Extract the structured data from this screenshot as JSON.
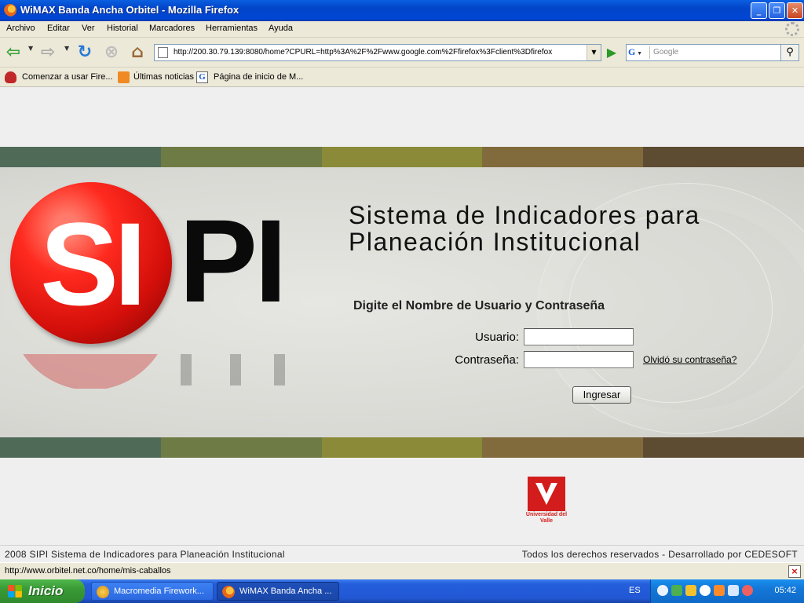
{
  "window": {
    "title": "WiMAX Banda Ancha Orbitel - Mozilla Firefox",
    "minimize_glyph": "_",
    "maximize_glyph": "❐",
    "close_glyph": "✕"
  },
  "menu": {
    "items": [
      "Archivo",
      "Editar",
      "Ver",
      "Historial",
      "Marcadores",
      "Herramientas",
      "Ayuda"
    ]
  },
  "navbar": {
    "url": "http://200.30.79.139:8080/home?CPURL=http%3A%2F%2Fwww.google.com%2Ffirefox%3Fclient%3Dfirefox",
    "search_engine": "G",
    "search_placeholder": "Google"
  },
  "bookmarks": {
    "items": [
      "Comenzar a usar Fire...",
      "Últimas noticias",
      "Página de inicio de M..."
    ]
  },
  "page": {
    "stripe_colors": [
      "#4F6B58",
      "#6F7B45",
      "#8A8A38",
      "#816A3C",
      "#5E4C32"
    ],
    "logo_left": "SI",
    "logo_right": "PI",
    "system_title_line1": "Sistema de Indicadores para",
    "system_title_line2": "Planeación Institucional",
    "login_prompt": "Digite el Nombre de Usuario y Contraseña",
    "username_label": "Usuario:",
    "password_label": "Contraseña:",
    "username_value": "",
    "password_value": "",
    "forgot_link": "Olvidó su contraseña?",
    "submit_label": "Ingresar",
    "university_logo_text": "Universidad del Valle",
    "footer_left": "2008 SIPI Sistema de Indicadores para Planeación Institucional",
    "footer_right": "Todos los derechos reservados  -  Desarrollado por CEDESOFT"
  },
  "status": {
    "text": "http://www.orbitel.net.co/home/mis-caballos"
  },
  "taskbar": {
    "start_label": "Inicio",
    "tasks": [
      "Macromedia Firework...",
      "WiMAX Banda Ancha ..."
    ],
    "language": "ES",
    "clock": "05:42"
  }
}
